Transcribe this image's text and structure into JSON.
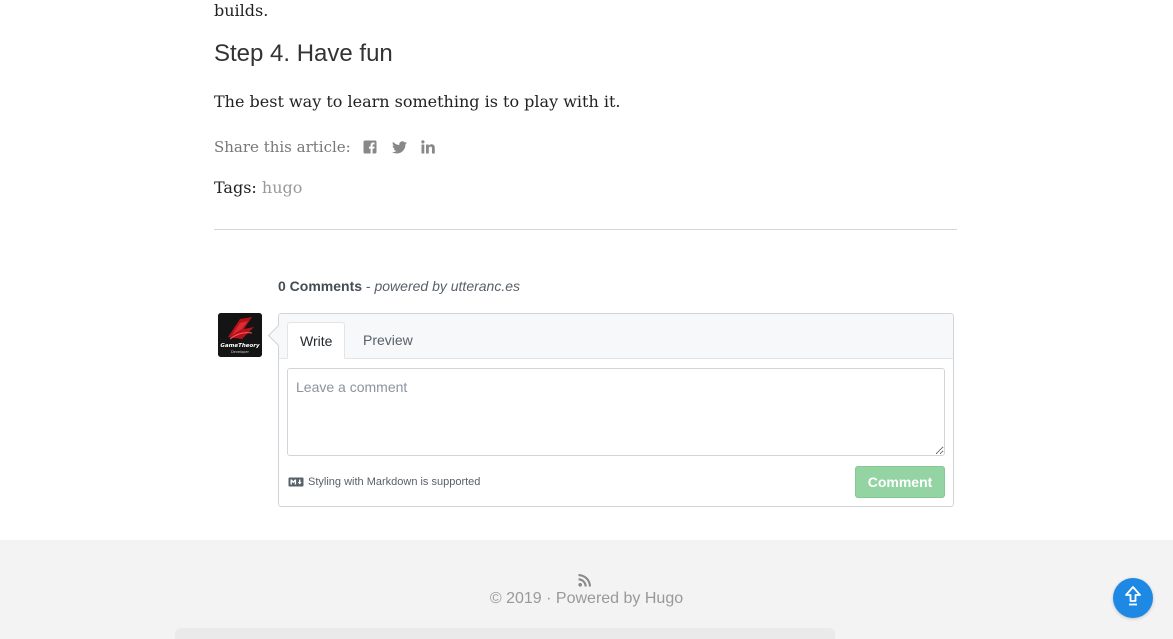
{
  "article": {
    "previous_text_end": "builds.",
    "step_heading": "Step 4. Have fun",
    "step_text": "The best way to learn something is to play with it.",
    "share_label": "Share this article:",
    "share_icons": [
      "facebook-icon",
      "twitter-icon",
      "linkedin-icon"
    ],
    "tags_label": "Tags:",
    "tags": [
      "hugo"
    ]
  },
  "comments": {
    "count_label": "0 Comments",
    "separator": " - ",
    "powered_by": "powered by utteranc.es",
    "avatar_text": [
      "GameTheory",
      "Developer"
    ],
    "tabs": {
      "write": "Write",
      "preview": "Preview"
    },
    "textarea_placeholder": "Leave a comment",
    "textarea_value": "",
    "markdown_note": "Styling with Markdown is supported",
    "submit_label": "Comment"
  },
  "footer": {
    "copyright": "© 2019 · ",
    "powered_prefix": "Powered by ",
    "powered_link": "Hugo"
  },
  "colors": {
    "accent_blue": "#1e88e5",
    "comment_button_disabled": "#94d3a2",
    "footer_bg": "#f3f3f3",
    "muted_text": "#999999"
  }
}
